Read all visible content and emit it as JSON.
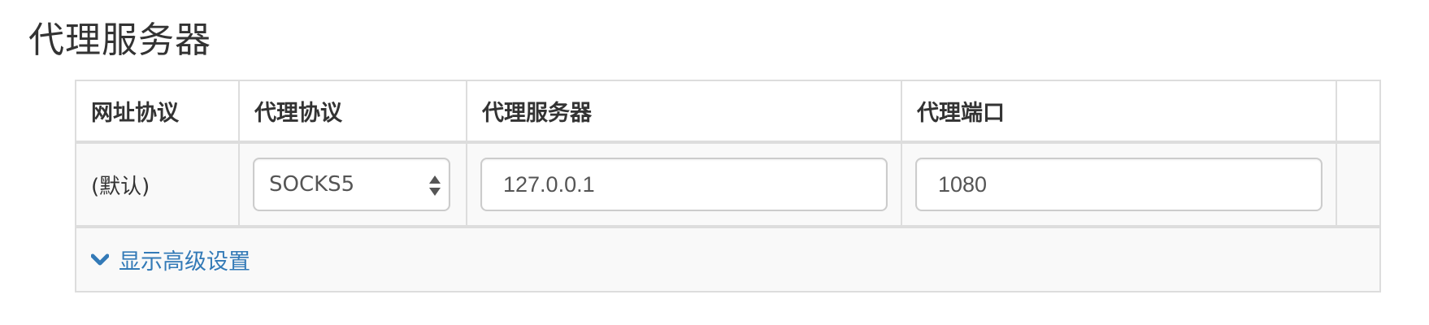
{
  "section": {
    "title": "代理服务器"
  },
  "table": {
    "headers": {
      "url_scheme": "网址协议",
      "proxy_protocol": "代理协议",
      "proxy_server": "代理服务器",
      "proxy_port": "代理端口",
      "actions": ""
    },
    "default_row": {
      "scheme": "(默认)",
      "protocol": "SOCKS5",
      "server": "127.0.0.1",
      "port": "1080"
    }
  },
  "advanced": {
    "label": "显示高级设置",
    "icon": "chevron-down-icon"
  },
  "colors": {
    "link": "#337ab7",
    "border": "#dddddd",
    "row_background": "#f9f9f9"
  }
}
